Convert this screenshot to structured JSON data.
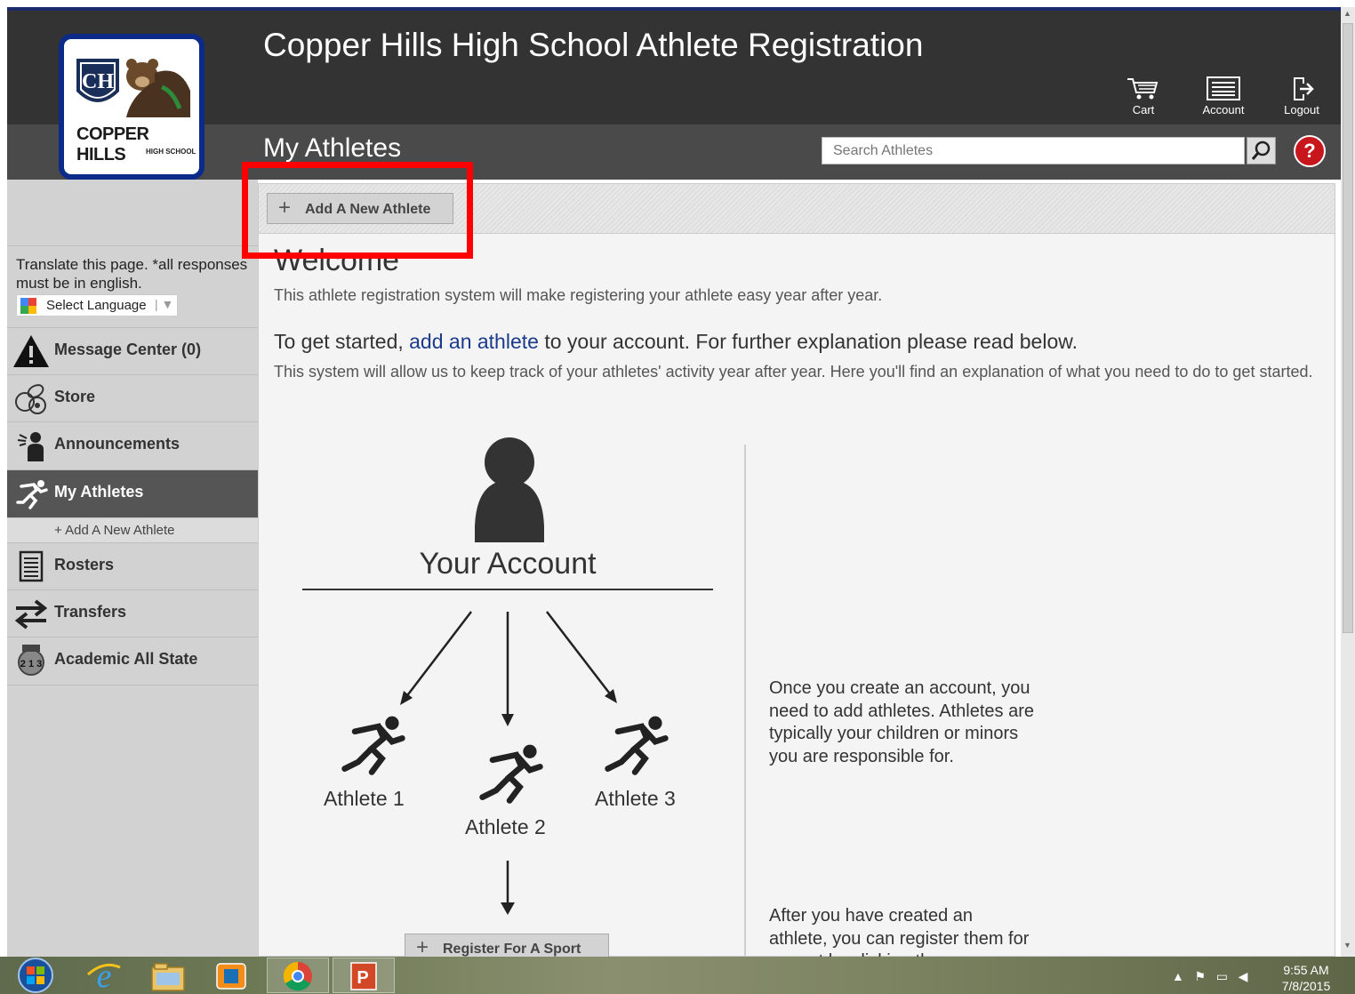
{
  "header": {
    "title": "Copper Hills High School Athlete Registration",
    "cart_label": "Cart",
    "account_label": "Account",
    "logout_label": "Logout"
  },
  "logo": {
    "line1": "COPPER HILLS",
    "line2": "HIGH SCHOOL"
  },
  "subheader": {
    "page_title": "My Athletes",
    "search_placeholder": "Search Athletes",
    "help_label": "?"
  },
  "sidebar": {
    "translate_text": "Translate this page. *all responses must be in english.",
    "language_select": "Select Language",
    "items": [
      {
        "label": "Message Center (0)",
        "icon": "warning-icon"
      },
      {
        "label": "Store",
        "icon": "sports-balls-icon"
      },
      {
        "label": "Announcements",
        "icon": "announcer-icon"
      },
      {
        "label": "My Athletes",
        "icon": "runner-icon",
        "active": true
      },
      {
        "label": "Rosters",
        "icon": "roster-icon"
      },
      {
        "label": "Transfers",
        "icon": "transfer-arrows-icon"
      },
      {
        "label": "Academic All State",
        "icon": "medal-icon"
      }
    ],
    "sub_item": "+ Add A New Athlete"
  },
  "toolbar": {
    "add_athlete": "Add A New Athlete",
    "plus": "+"
  },
  "main": {
    "welcome": "Welcome",
    "intro": "This athlete registration system will make registering your athlete easy year after year.",
    "getstarted_pre": "To get started, ",
    "getstarted_link": "add an athlete",
    "getstarted_post": " to your account. For further explanation please read below.",
    "explain": "This system will allow us to keep track of your athletes' activity year after year. Here you'll find an explanation of what you need to do to get started.",
    "your_account": "Your Account",
    "athlete1": "Athlete 1",
    "athlete2": "Athlete 2",
    "athlete3": "Athlete 3",
    "register_btn": "Register For A Sport",
    "right_text1": "Once you create an account, you need to add athletes. Athletes are typically your children or minors you are responsible for.",
    "right_text2": "After you have created an athlete, you can register them for a sport by clicking the"
  },
  "taskbar": {
    "time": "9:55 AM",
    "date": "7/8/2015"
  },
  "colors": {
    "accent_blue": "#1a3a8a",
    "highlight_red": "#ff0000",
    "help_red": "#c8161d",
    "header_dark": "#333333"
  }
}
